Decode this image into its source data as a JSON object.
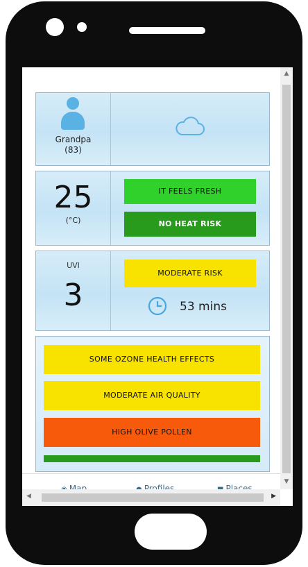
{
  "profile": {
    "name": "Grandpa",
    "age": "(83)",
    "icon": "person-icon"
  },
  "weather": {
    "icon": "cloud-icon"
  },
  "temperature": {
    "value": "25",
    "unit": "(°C)",
    "feel_label": "IT FEELS FRESH",
    "heat_label": "NO HEAT RISK"
  },
  "uv": {
    "label": "UVI",
    "value": "3",
    "risk_label": "MODERATE RISK",
    "time_icon": "clock-icon",
    "time": "53 mins"
  },
  "alerts": [
    {
      "label": "SOME OZONE HEALTH EFFECTS",
      "color": "#f7e200"
    },
    {
      "label": "MODERATE AIR QUALITY",
      "color": "#f7e200"
    },
    {
      "label": "HIGH OLIVE POLLEN",
      "color": "#f65a0a"
    }
  ],
  "nav": {
    "map": "Map",
    "profiles": "Profiles",
    "places": "Places"
  },
  "colors": {
    "fresh": "#2fd12a",
    "no_heat": "#289a1c",
    "moderate": "#f7e200",
    "high": "#f65a0a",
    "avatar": "#5ab2e4"
  }
}
